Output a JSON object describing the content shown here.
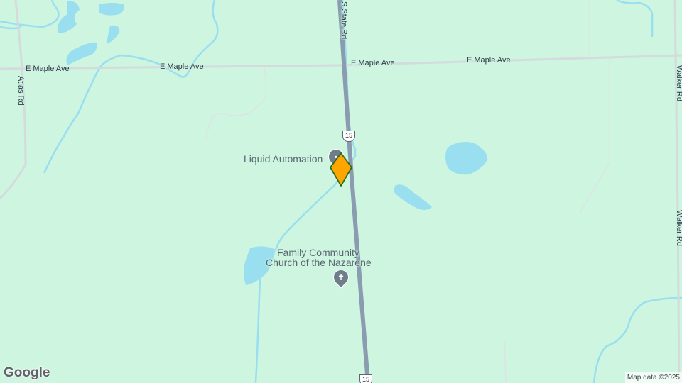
{
  "map": {
    "roads": {
      "e_maple_ave": "E Maple Ave",
      "s_state_rd": "S State Rd",
      "atlas_rd": "Atlas Rd",
      "walker_rd": "Walker Rd",
      "route_15": "15"
    },
    "pois": {
      "liquid_automation": "Liquid Automation",
      "church_line1": "Family Community",
      "church_line2": "Church of the Nazarene"
    },
    "marker": {
      "color": "#ffa500",
      "border": "#2b6b1f"
    },
    "colors": {
      "land": "#cdf5e0",
      "water": "#99dff0",
      "highway": "#8b9bb0"
    }
  },
  "branding": {
    "logo": "Google",
    "attribution": "Map data ©2025"
  }
}
